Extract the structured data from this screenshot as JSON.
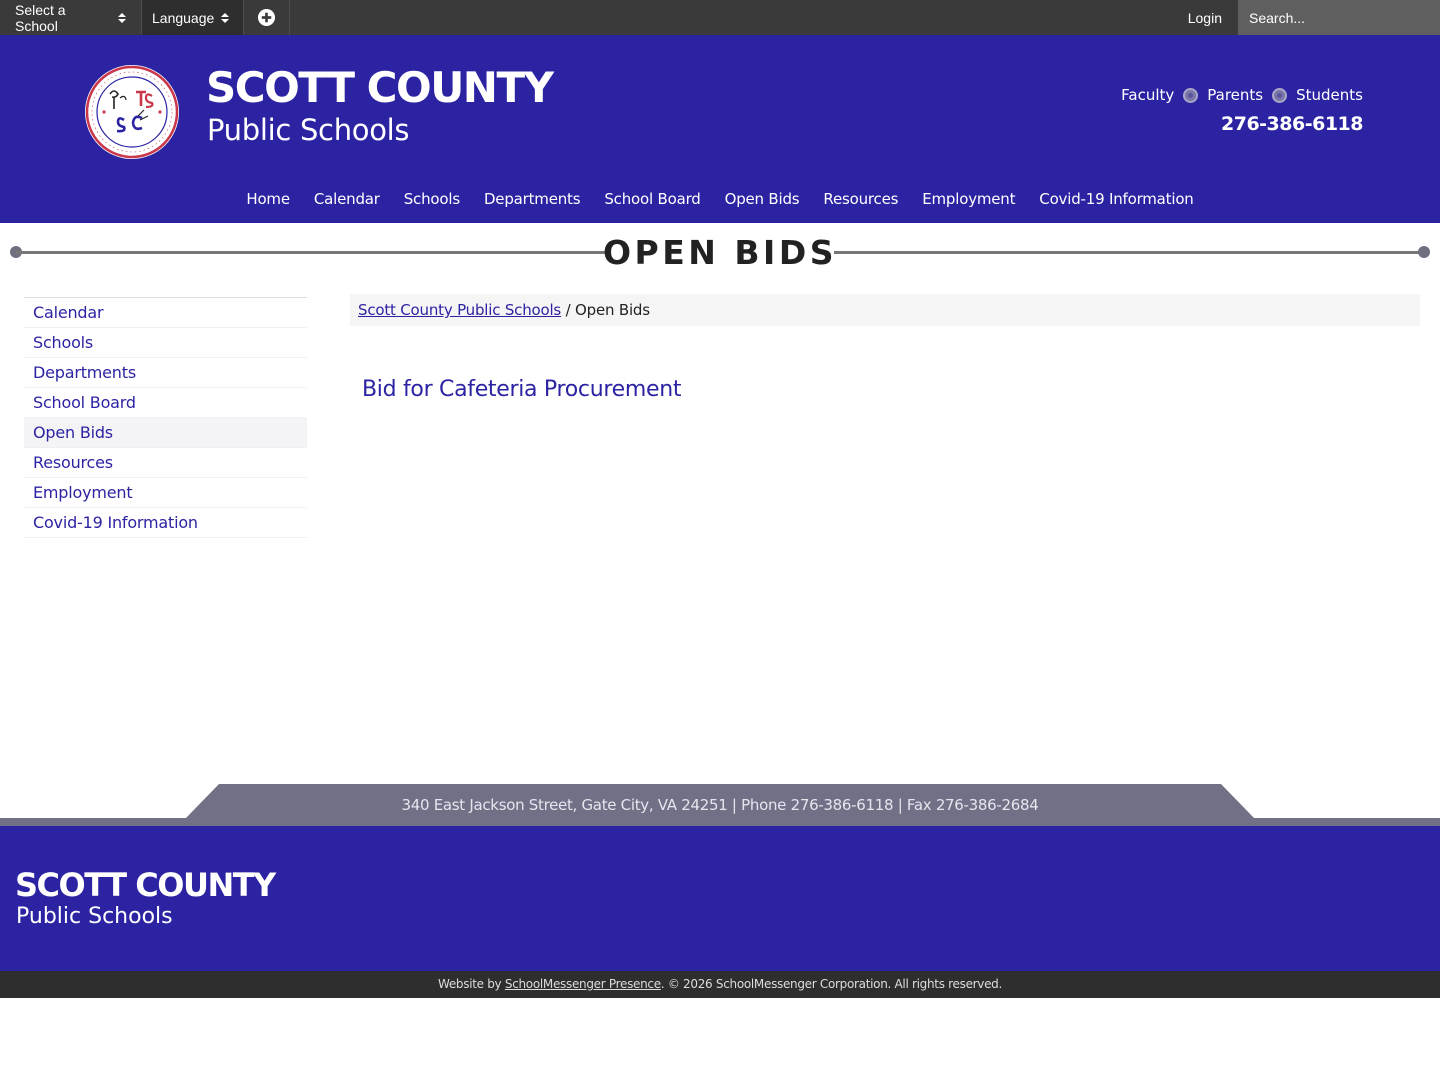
{
  "topbar": {
    "school_select": "Select a School",
    "language_select": "Language",
    "login": "Login",
    "search_placeholder": "Search..."
  },
  "header": {
    "title": "SCOTT COUNTY",
    "subtitle": "Public Schools",
    "quick_links": [
      "Faculty",
      "Parents",
      "Students"
    ],
    "phone": "276-386-6118"
  },
  "nav": [
    "Home",
    "Calendar",
    "Schools",
    "Departments",
    "School Board",
    "Open Bids",
    "Resources",
    "Employment",
    "Covid-19 Information"
  ],
  "page": {
    "title": "OPEN BIDS",
    "breadcrumb_home": "Scott County Public Schools",
    "breadcrumb_sep": " / ",
    "breadcrumb_current": "Open Bids",
    "bid_link": "Bid for Cafeteria Procurement"
  },
  "sidebar": [
    "Calendar",
    "Schools",
    "Departments",
    "School Board",
    "Open Bids",
    "Resources",
    "Employment",
    "Covid-19 Information"
  ],
  "sidebar_active": "Open Bids",
  "footer": {
    "address": "340 East Jackson Street, Gate City, VA 24251 | Phone 276-386-6118 | Fax 276-386-2684",
    "title": "SCOTT COUNTY",
    "subtitle": "Public Schools",
    "credit_prefix": "Website by ",
    "credit_link": "SchoolMessenger Presence",
    "credit_suffix": ". © 2026 SchoolMessenger Corporation. All rights reserved."
  },
  "colors": {
    "brand_blue": "#2c23a3",
    "topbar": "#3a3a3a",
    "footer_gray": "#707087"
  }
}
